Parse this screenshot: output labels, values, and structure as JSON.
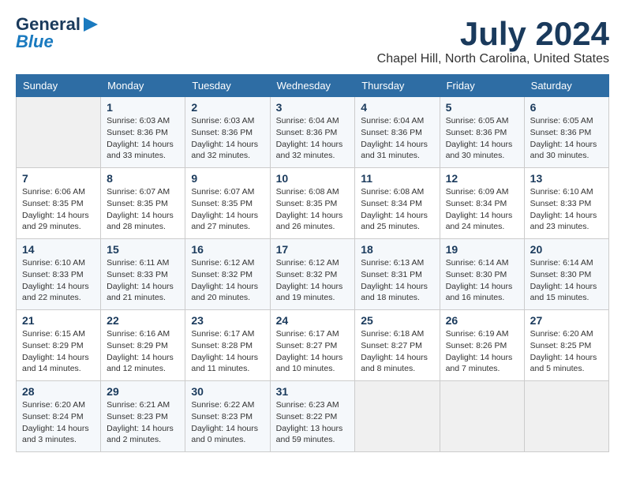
{
  "header": {
    "logo_general": "General",
    "logo_blue": "Blue",
    "month": "July 2024",
    "location": "Chapel Hill, North Carolina, United States"
  },
  "days_of_week": [
    "Sunday",
    "Monday",
    "Tuesday",
    "Wednesday",
    "Thursday",
    "Friday",
    "Saturday"
  ],
  "weeks": [
    [
      {
        "day": "",
        "sunrise": "",
        "sunset": "",
        "daylight": ""
      },
      {
        "day": "1",
        "sunrise": "Sunrise: 6:03 AM",
        "sunset": "Sunset: 8:36 PM",
        "daylight": "Daylight: 14 hours and 33 minutes."
      },
      {
        "day": "2",
        "sunrise": "Sunrise: 6:03 AM",
        "sunset": "Sunset: 8:36 PM",
        "daylight": "Daylight: 14 hours and 32 minutes."
      },
      {
        "day": "3",
        "sunrise": "Sunrise: 6:04 AM",
        "sunset": "Sunset: 8:36 PM",
        "daylight": "Daylight: 14 hours and 32 minutes."
      },
      {
        "day": "4",
        "sunrise": "Sunrise: 6:04 AM",
        "sunset": "Sunset: 8:36 PM",
        "daylight": "Daylight: 14 hours and 31 minutes."
      },
      {
        "day": "5",
        "sunrise": "Sunrise: 6:05 AM",
        "sunset": "Sunset: 8:36 PM",
        "daylight": "Daylight: 14 hours and 30 minutes."
      },
      {
        "day": "6",
        "sunrise": "Sunrise: 6:05 AM",
        "sunset": "Sunset: 8:36 PM",
        "daylight": "Daylight: 14 hours and 30 minutes."
      }
    ],
    [
      {
        "day": "7",
        "sunrise": "Sunrise: 6:06 AM",
        "sunset": "Sunset: 8:35 PM",
        "daylight": "Daylight: 14 hours and 29 minutes."
      },
      {
        "day": "8",
        "sunrise": "Sunrise: 6:07 AM",
        "sunset": "Sunset: 8:35 PM",
        "daylight": "Daylight: 14 hours and 28 minutes."
      },
      {
        "day": "9",
        "sunrise": "Sunrise: 6:07 AM",
        "sunset": "Sunset: 8:35 PM",
        "daylight": "Daylight: 14 hours and 27 minutes."
      },
      {
        "day": "10",
        "sunrise": "Sunrise: 6:08 AM",
        "sunset": "Sunset: 8:35 PM",
        "daylight": "Daylight: 14 hours and 26 minutes."
      },
      {
        "day": "11",
        "sunrise": "Sunrise: 6:08 AM",
        "sunset": "Sunset: 8:34 PM",
        "daylight": "Daylight: 14 hours and 25 minutes."
      },
      {
        "day": "12",
        "sunrise": "Sunrise: 6:09 AM",
        "sunset": "Sunset: 8:34 PM",
        "daylight": "Daylight: 14 hours and 24 minutes."
      },
      {
        "day": "13",
        "sunrise": "Sunrise: 6:10 AM",
        "sunset": "Sunset: 8:33 PM",
        "daylight": "Daylight: 14 hours and 23 minutes."
      }
    ],
    [
      {
        "day": "14",
        "sunrise": "Sunrise: 6:10 AM",
        "sunset": "Sunset: 8:33 PM",
        "daylight": "Daylight: 14 hours and 22 minutes."
      },
      {
        "day": "15",
        "sunrise": "Sunrise: 6:11 AM",
        "sunset": "Sunset: 8:33 PM",
        "daylight": "Daylight: 14 hours and 21 minutes."
      },
      {
        "day": "16",
        "sunrise": "Sunrise: 6:12 AM",
        "sunset": "Sunset: 8:32 PM",
        "daylight": "Daylight: 14 hours and 20 minutes."
      },
      {
        "day": "17",
        "sunrise": "Sunrise: 6:12 AM",
        "sunset": "Sunset: 8:32 PM",
        "daylight": "Daylight: 14 hours and 19 minutes."
      },
      {
        "day": "18",
        "sunrise": "Sunrise: 6:13 AM",
        "sunset": "Sunset: 8:31 PM",
        "daylight": "Daylight: 14 hours and 18 minutes."
      },
      {
        "day": "19",
        "sunrise": "Sunrise: 6:14 AM",
        "sunset": "Sunset: 8:30 PM",
        "daylight": "Daylight: 14 hours and 16 minutes."
      },
      {
        "day": "20",
        "sunrise": "Sunrise: 6:14 AM",
        "sunset": "Sunset: 8:30 PM",
        "daylight": "Daylight: 14 hours and 15 minutes."
      }
    ],
    [
      {
        "day": "21",
        "sunrise": "Sunrise: 6:15 AM",
        "sunset": "Sunset: 8:29 PM",
        "daylight": "Daylight: 14 hours and 14 minutes."
      },
      {
        "day": "22",
        "sunrise": "Sunrise: 6:16 AM",
        "sunset": "Sunset: 8:29 PM",
        "daylight": "Daylight: 14 hours and 12 minutes."
      },
      {
        "day": "23",
        "sunrise": "Sunrise: 6:17 AM",
        "sunset": "Sunset: 8:28 PM",
        "daylight": "Daylight: 14 hours and 11 minutes."
      },
      {
        "day": "24",
        "sunrise": "Sunrise: 6:17 AM",
        "sunset": "Sunset: 8:27 PM",
        "daylight": "Daylight: 14 hours and 10 minutes."
      },
      {
        "day": "25",
        "sunrise": "Sunrise: 6:18 AM",
        "sunset": "Sunset: 8:27 PM",
        "daylight": "Daylight: 14 hours and 8 minutes."
      },
      {
        "day": "26",
        "sunrise": "Sunrise: 6:19 AM",
        "sunset": "Sunset: 8:26 PM",
        "daylight": "Daylight: 14 hours and 7 minutes."
      },
      {
        "day": "27",
        "sunrise": "Sunrise: 6:20 AM",
        "sunset": "Sunset: 8:25 PM",
        "daylight": "Daylight: 14 hours and 5 minutes."
      }
    ],
    [
      {
        "day": "28",
        "sunrise": "Sunrise: 6:20 AM",
        "sunset": "Sunset: 8:24 PM",
        "daylight": "Daylight: 14 hours and 3 minutes."
      },
      {
        "day": "29",
        "sunrise": "Sunrise: 6:21 AM",
        "sunset": "Sunset: 8:23 PM",
        "daylight": "Daylight: 14 hours and 2 minutes."
      },
      {
        "day": "30",
        "sunrise": "Sunrise: 6:22 AM",
        "sunset": "Sunset: 8:23 PM",
        "daylight": "Daylight: 14 hours and 0 minutes."
      },
      {
        "day": "31",
        "sunrise": "Sunrise: 6:23 AM",
        "sunset": "Sunset: 8:22 PM",
        "daylight": "Daylight: 13 hours and 59 minutes."
      },
      {
        "day": "",
        "sunrise": "",
        "sunset": "",
        "daylight": ""
      },
      {
        "day": "",
        "sunrise": "",
        "sunset": "",
        "daylight": ""
      },
      {
        "day": "",
        "sunrise": "",
        "sunset": "",
        "daylight": ""
      }
    ]
  ]
}
